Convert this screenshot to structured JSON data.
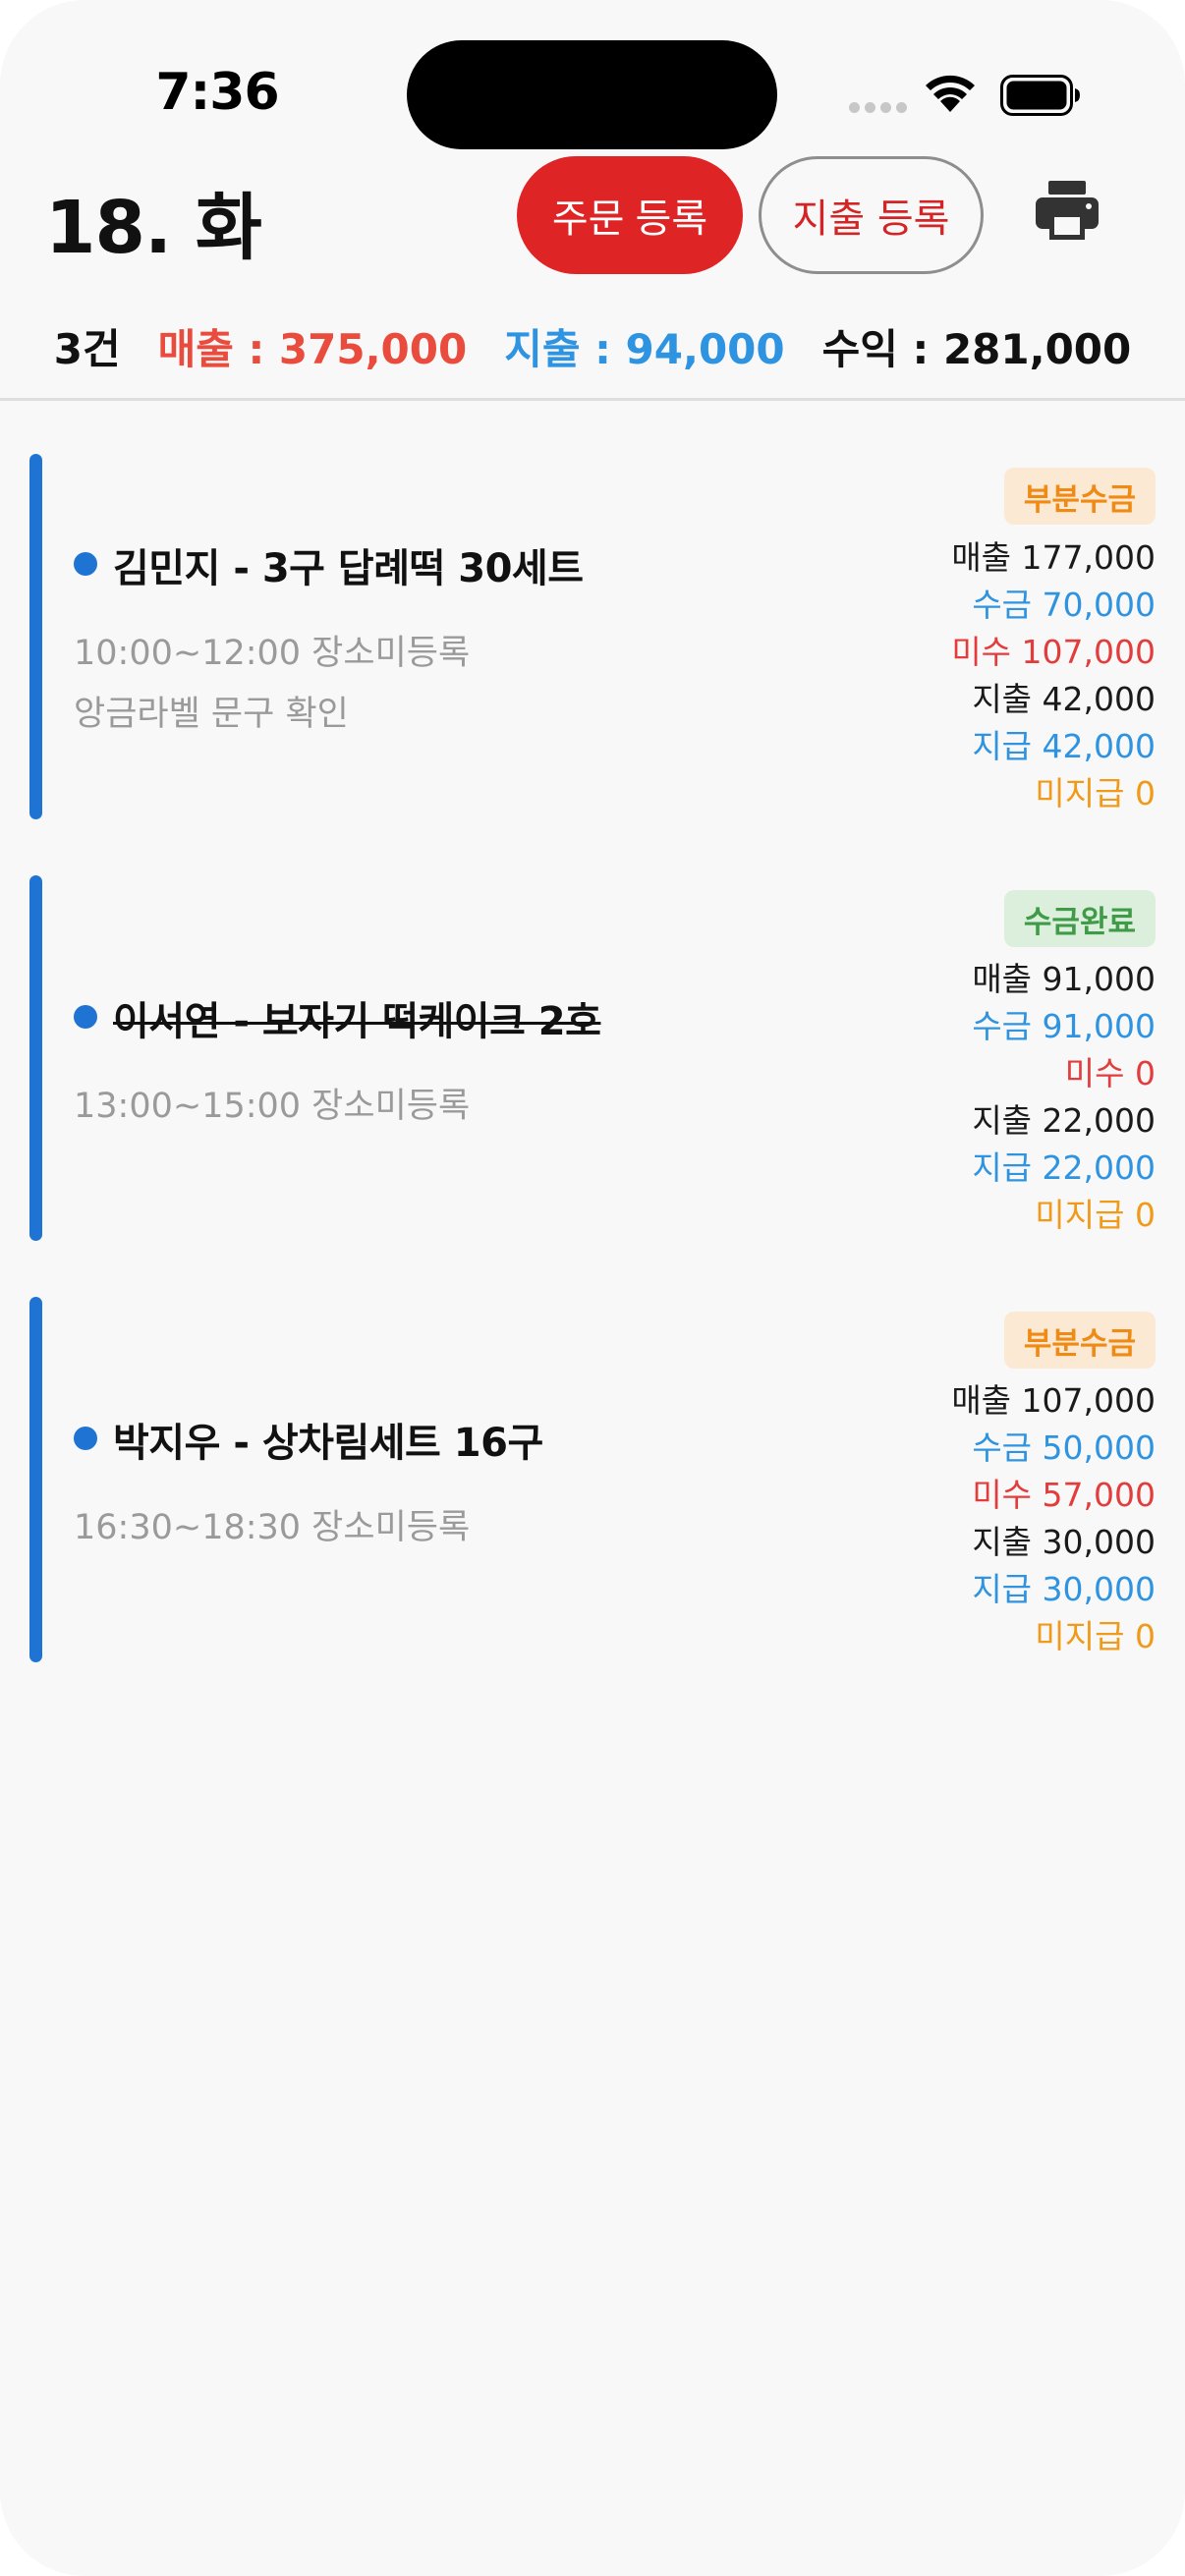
{
  "status_bar": {
    "time": "7:36"
  },
  "header": {
    "date": "18. 화",
    "order_button": "주문 등록",
    "expense_button": "지출 등록"
  },
  "summary": {
    "count": "3건",
    "sales": "매출 : 375,000",
    "expense": "지출 : 94,000",
    "profit": "수익 : 281,000"
  },
  "orders": [
    {
      "status": "부분수금",
      "title": "김민지 - 3구 답례떡 30세트",
      "time_place": "10:00~12:00 장소미등록",
      "memo": "앙금라벨 문구 확인",
      "sales": "매출 177,000",
      "received": "수금 70,000",
      "unreceived": "미수 107,000",
      "expense": "지출 42,000",
      "paid": "지급 42,000",
      "unpaid": "미지급 0"
    },
    {
      "status": "수금완료",
      "title": "이서연 - 보자기 떡케이크 2호",
      "time_place": "13:00~15:00 장소미등록",
      "memo": "",
      "sales": "매출 91,000",
      "received": "수금 91,000",
      "unreceived": "미수 0",
      "expense": "지출 22,000",
      "paid": "지급 22,000",
      "unpaid": "미지급 0"
    },
    {
      "status": "부분수금",
      "title": "박지우 - 상차림세트 16구",
      "time_place": "16:30~18:30 장소미등록",
      "memo": "",
      "sales": "매출 107,000",
      "received": "수금 50,000",
      "unreceived": "미수 57,000",
      "expense": "지출 30,000",
      "paid": "지급 30,000",
      "unpaid": "미지급 0"
    }
  ],
  "colors": {
    "primary_red": "#df2426",
    "accent_blue": "#1f74d3",
    "sales_red": "#e94b3c",
    "expense_blue": "#2e93e0",
    "partial_orange": "#ef8a14",
    "complete_green": "#3f9b47"
  },
  "icons": {
    "wifi": "wifi-icon",
    "battery": "battery-icon",
    "print": "printer-icon",
    "signal": "cellular-signal-icon"
  }
}
